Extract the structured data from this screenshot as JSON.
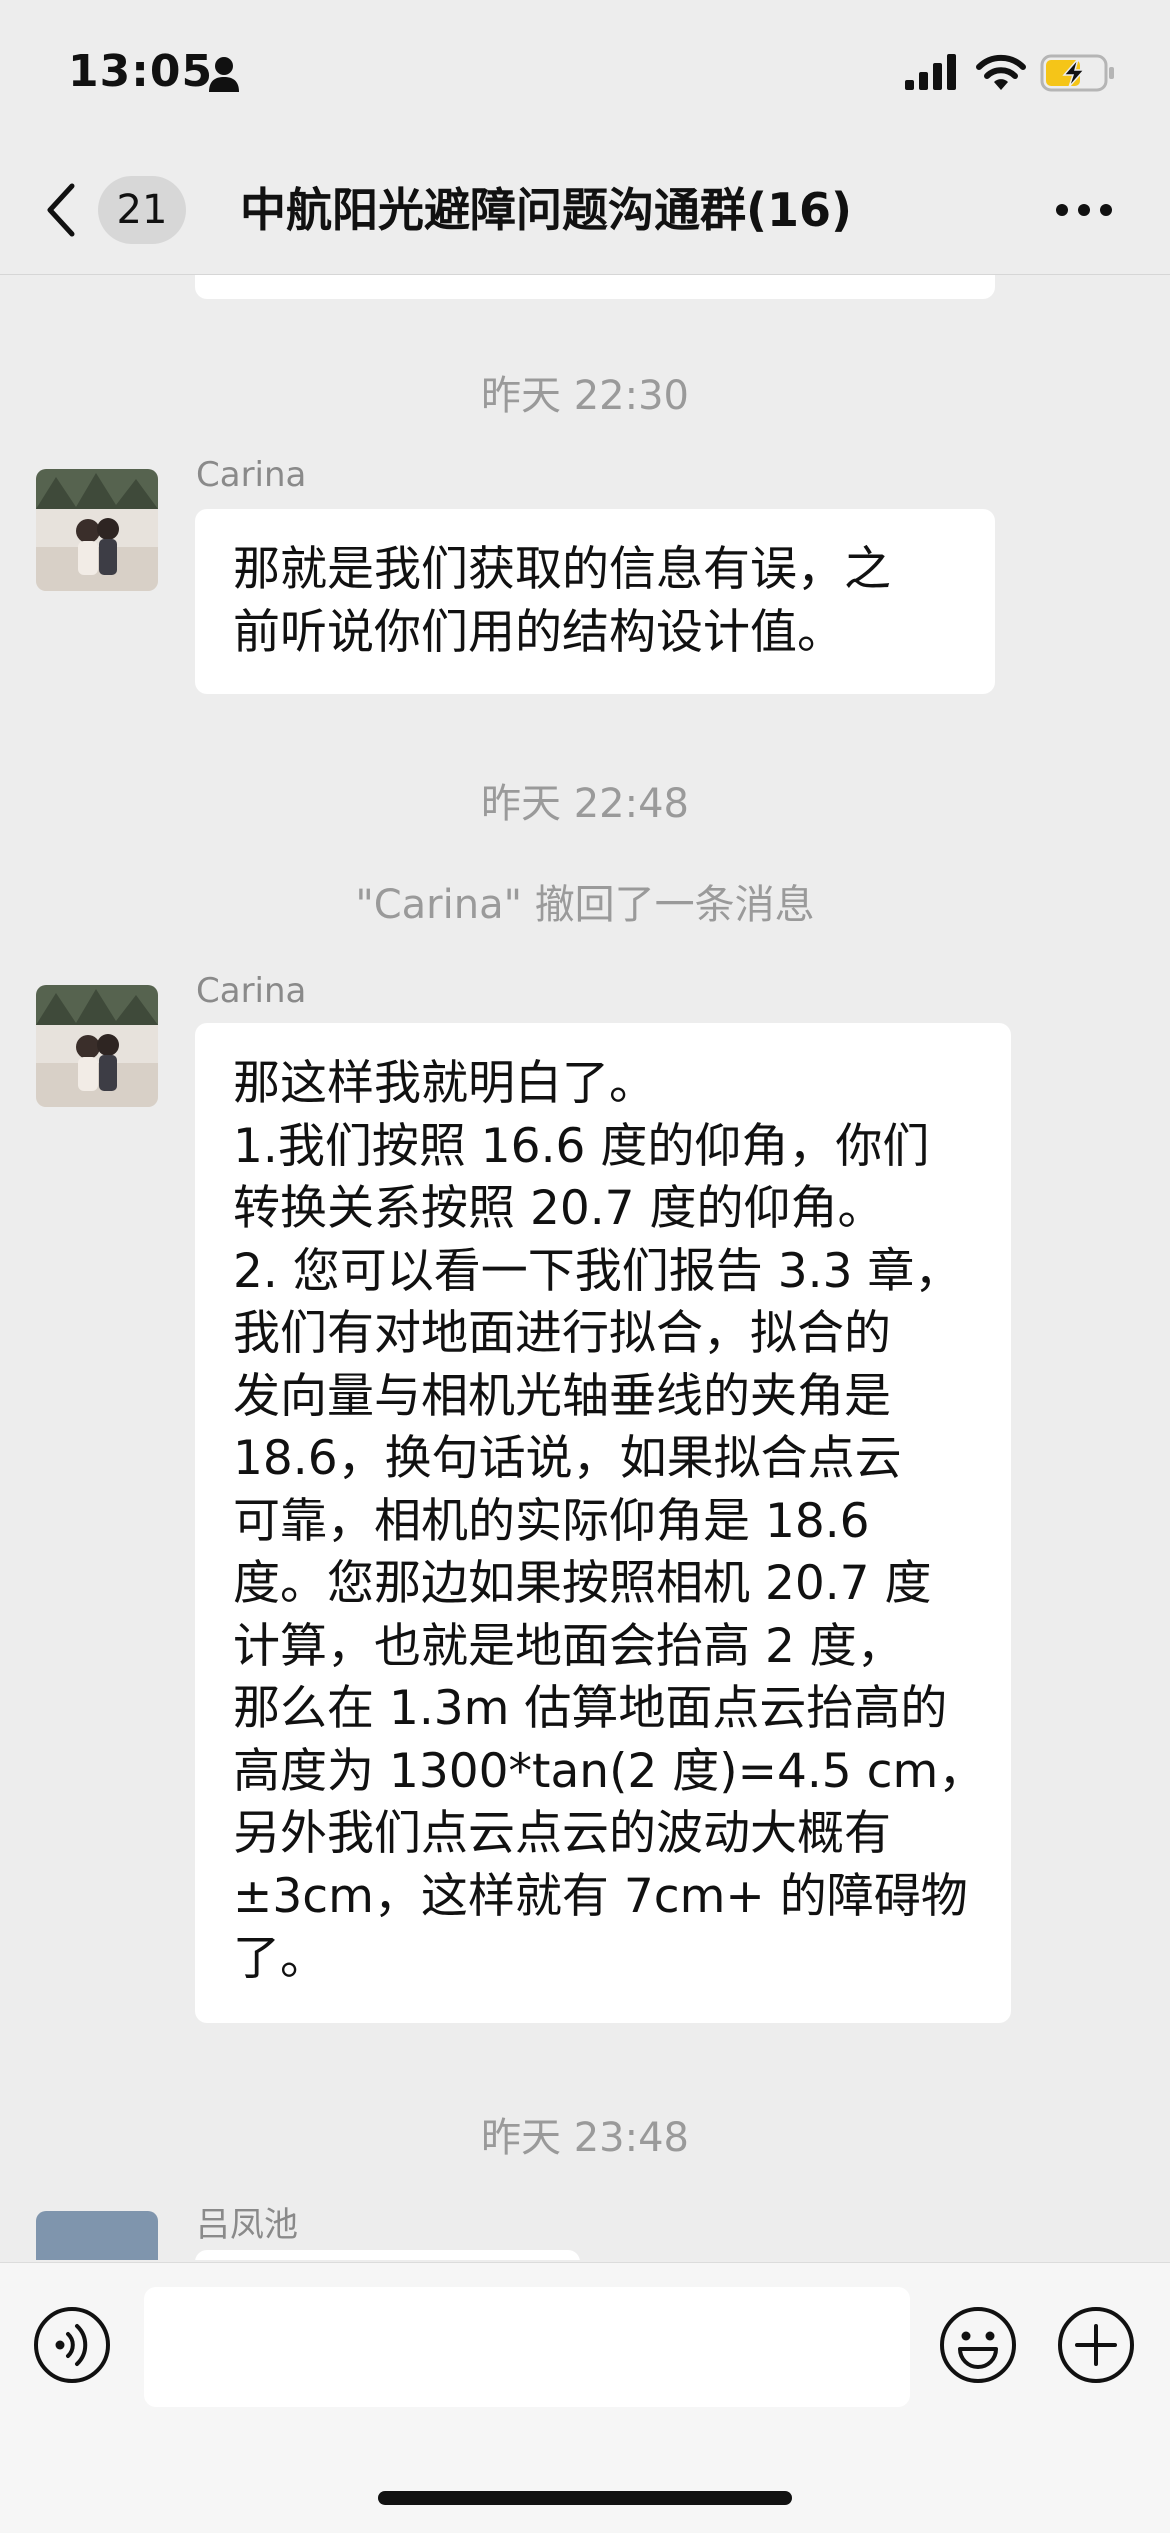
{
  "status_bar": {
    "time": "13:05",
    "icons": [
      "person-icon",
      "signal-icon",
      "wifi-icon",
      "battery-charging-icon"
    ]
  },
  "nav": {
    "unread_count": "21",
    "title": "中航阳光避障问题沟通群(16)",
    "icons": [
      "back-chevron-icon",
      "more-dots-icon"
    ]
  },
  "messages": [
    {
      "type": "timestamp",
      "text": "昨天 22:30"
    },
    {
      "type": "message",
      "sender": "Carina",
      "lines": [
        "那就是我们获取的信息有误，之",
        "前听说你们用的结构设计值。"
      ]
    },
    {
      "type": "timestamp",
      "text": "昨天 22:48"
    },
    {
      "type": "notice",
      "text": "\"Carina\" 撤回了一条消息"
    },
    {
      "type": "message",
      "sender": "Carina",
      "lines": [
        "那这样我就明白了。",
        "1.我们按照 16.6 度的仰角，你们",
        "转换关系按照 20.7 度的仰角。",
        "2. 您可以看一下我们报告 3.3 章，",
        "我们有对地面进行拟合，拟合的",
        "发向量与相机光轴垂线的夹角是",
        "18.6，换句话说，如果拟合点云",
        "可靠，相机的实际仰角是 18.6",
        "度。您那边如果按照相机 20.7 度",
        "计算，也就是地面会抬高 2 度，",
        "那么在 1.3m 估算地面点云抬高的",
        "高度为 1300*tan(2 度)=4.5 cm，",
        "另外我们点云点云的波动大概有",
        "±3cm，这样就有 7cm+ 的障碍物",
        "了。"
      ]
    },
    {
      "type": "timestamp",
      "text": "昨天 23:48"
    },
    {
      "type": "message",
      "sender": "吕凤池",
      "lines": []
    }
  ],
  "input_bar": {
    "placeholder": "",
    "icons": [
      "voice-icon",
      "emoji-icon",
      "plus-icon"
    ]
  }
}
